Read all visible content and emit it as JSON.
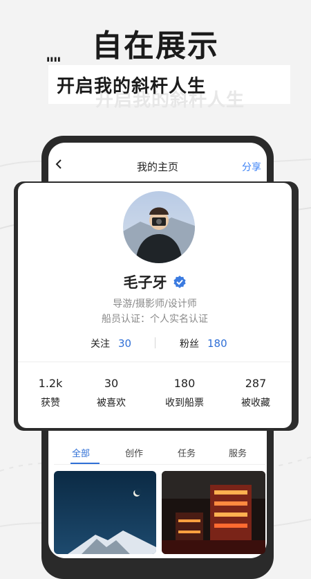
{
  "promo": {
    "headline": "自在展示",
    "subhead": "开启我的斜杆人生",
    "ghost_subhead": "开启我的斜杆人生",
    "quote_mark": "\"\""
  },
  "nav": {
    "title": "我的主页",
    "share_label": "分享"
  },
  "profile": {
    "name": "毛子牙",
    "roles": "导游/摄影师/设计师",
    "certification": "船员认证：个人实名认证",
    "following_label": "关注",
    "following_count": "30",
    "fans_label": "粉丝",
    "fans_count": "180"
  },
  "stats": [
    {
      "value": "1.2k",
      "label": "获赞"
    },
    {
      "value": "30",
      "label": "被喜欢"
    },
    {
      "value": "180",
      "label": "收到船票"
    },
    {
      "value": "287",
      "label": "被收藏"
    }
  ],
  "tabs": [
    {
      "label": "全部",
      "active": true
    },
    {
      "label": "创作",
      "active": false
    },
    {
      "label": "任务",
      "active": false
    },
    {
      "label": "服务",
      "active": false
    }
  ],
  "colors": {
    "accent": "#2f6fd6",
    "share": "#3b82f6",
    "dark": "#2a2a2a"
  }
}
